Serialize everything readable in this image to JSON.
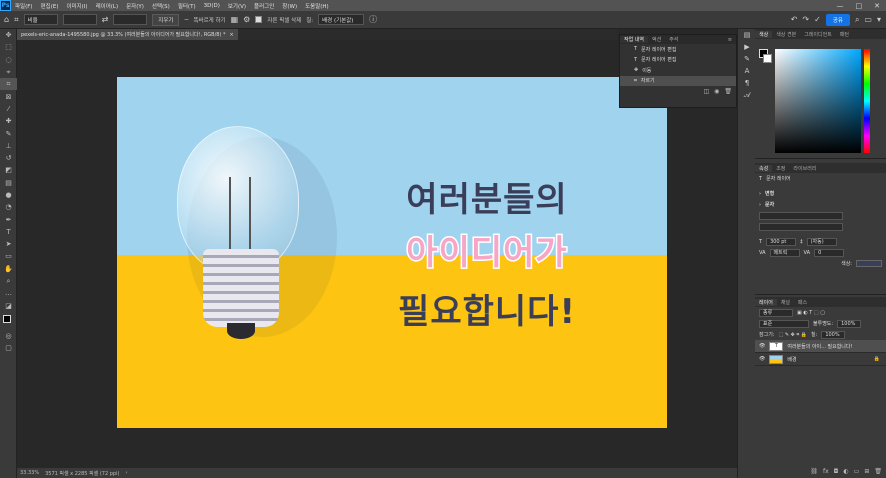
{
  "app": {
    "logo": "Ps"
  },
  "menu": [
    "파일(F)",
    "편집(E)",
    "이미지(I)",
    "레이어(L)",
    "문자(Y)",
    "선택(S)",
    "필터(T)",
    "3D(D)",
    "보기(V)",
    "플러그인",
    "창(W)",
    "도움말(H)"
  ],
  "window_buttons": [
    "—",
    "□",
    "✕"
  ],
  "options": {
    "ratio": "비율",
    "clear": "지우기",
    "straighten": "똑바르게 하기",
    "delete_cropped": "자른 픽셀 삭제",
    "fill_label": "칠:",
    "fill_value": "배경 (기본값)",
    "share": "공유"
  },
  "document": {
    "tab": "pexels-eric-anada-1495580.jpg @ 33.3% (여러분들의 아이디어가 필요합니다!, RGB/8) *",
    "zoom": "33.33%",
    "size": "3571 픽셀 x 2285 픽셀 (72 ppi)",
    "line1": "여러분들의",
    "line2": "아이디어가",
    "line3": "필요합니다!"
  },
  "history": {
    "tabs": [
      "작업 내역",
      "액션",
      "주석"
    ],
    "items": [
      "문자 레이어 편집",
      "문자 레이어 편집",
      "이동",
      "자르기"
    ]
  },
  "color_panel": {
    "tabs": [
      "색상",
      "색상 견본",
      "그레이디언트",
      "패턴"
    ]
  },
  "properties": {
    "tabs": [
      "속성",
      "조정",
      "라이브러리"
    ],
    "type_label": "문자 레이어",
    "transform": "변형",
    "char": "문자",
    "size": "300 pt",
    "leading": "(자동)",
    "tracking_label": "메트릭",
    "tracking": "0",
    "color_label": "색상:"
  },
  "layers": {
    "tabs": [
      "레이어",
      "채널",
      "패스"
    ],
    "kind": "종류",
    "blend": "표준",
    "opacity_label": "불투명도:",
    "opacity": "100%",
    "lock_label": "잠그기:",
    "fill_label": "칠:",
    "fill": "100%",
    "items": [
      "여러분들의 아이... 필요합니다!",
      "배경"
    ]
  },
  "colors": {
    "accent": "#1473e6",
    "sky": "#9fd3ee",
    "yellow": "#fdc511",
    "text_dark": "#3b3e58",
    "text_pink": "#f7a6c6"
  }
}
